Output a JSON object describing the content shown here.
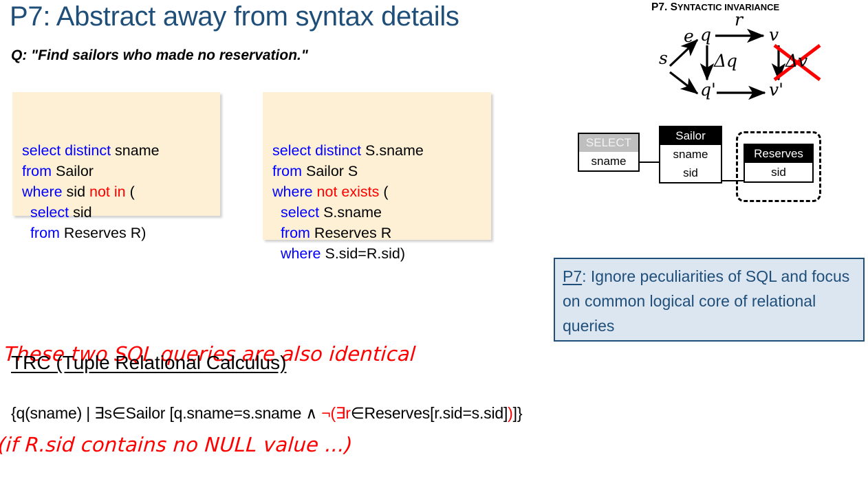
{
  "slide": {
    "title": "P7: Abstract away from syntax details",
    "question": "Q: \"Find sailors who made no reservation.\"",
    "title_color": "#1F4E79"
  },
  "code_blocks": [
    {
      "name": "sql-not-in",
      "background": "#FDF0D5",
      "lines": [
        [
          {
            "t": "select distinct ",
            "c": "kw"
          },
          {
            "t": "sname",
            "c": "id"
          }
        ],
        [
          {
            "t": "from ",
            "c": "kw"
          },
          {
            "t": "Sailor",
            "c": "id"
          }
        ],
        [
          {
            "t": "where ",
            "c": "kw"
          },
          {
            "t": "sid ",
            "c": "id"
          },
          {
            "t": "not in",
            "c": "neg"
          },
          {
            "t": " (",
            "c": "id"
          }
        ],
        [
          {
            "t": "  select ",
            "c": "kw"
          },
          {
            "t": "sid",
            "c": "id"
          }
        ],
        [
          {
            "t": "  from ",
            "c": "kw"
          },
          {
            "t": "Reserves R)",
            "c": "id"
          }
        ]
      ]
    },
    {
      "name": "sql-not-exists",
      "background": "#FDF0D5",
      "lines": [
        [
          {
            "t": "select distinct ",
            "c": "kw"
          },
          {
            "t": "S.sname",
            "c": "id"
          }
        ],
        [
          {
            "t": "from ",
            "c": "kw"
          },
          {
            "t": "Sailor S",
            "c": "id"
          }
        ],
        [
          {
            "t": "where ",
            "c": "kw"
          },
          {
            "t": "not exists",
            "c": "neg"
          },
          {
            "t": " (",
            "c": "id"
          }
        ],
        [
          {
            "t": "  select ",
            "c": "kw"
          },
          {
            "t": "S.sname",
            "c": "id"
          }
        ],
        [
          {
            "t": "  from ",
            "c": "kw"
          },
          {
            "t": "Reserves R",
            "c": "id"
          }
        ],
        [
          {
            "t": "  where ",
            "c": "kw"
          },
          {
            "t": "S.sid=R.sid)",
            "c": "id"
          }
        ]
      ]
    }
  ],
  "handwritten_note": {
    "line1": "These two SQL queries are also identical",
    "line2": "(if R.sid contains no NULL value ...)",
    "color": "#FF0000"
  },
  "trc": {
    "heading": "TRC (Tuple Relational Calculus)",
    "formula_parts": [
      {
        "t": "{q(sname) | ∃s∈Sailor [q.sname=s.sname ∧ ",
        "c": "id"
      },
      {
        "t": "¬(∃r",
        "c": "neg"
      },
      {
        "t": "∈Reserves[r.sid=s.sid]",
        "c": "id"
      },
      {
        "t": ")",
        "c": "neg"
      },
      {
        "t": "]}",
        "c": "id"
      }
    ]
  },
  "syntactic_diagram": {
    "title_first": "P7. S",
    "title_rest": "YNTACTIC INVARIANCE",
    "nodes": {
      "s": "s",
      "q": "q",
      "v": "v",
      "q_prime": "q'",
      "v_prime": "v'"
    },
    "edges": {
      "e": "e",
      "r": "r",
      "delta_q": "Δq",
      "delta_v": "Δv"
    },
    "cross_color": "#FF0000"
  },
  "relational_diagram": {
    "select_box": {
      "header": "SELECT",
      "cells": [
        "sname"
      ],
      "header_bg": "#BFBFBF"
    },
    "sailor_box": {
      "header": "Sailor",
      "cells": [
        "sname",
        "sid"
      ],
      "header_bg": "#000000"
    },
    "reserves_box": {
      "header": "Reserves",
      "cells": [
        "sid"
      ],
      "header_bg": "#000000"
    }
  },
  "callout": {
    "label": "P7",
    "text": ": Ignore peculiarities of SQL and focus on common logical core of relational queries",
    "background": "#DCE6F1",
    "border": "#1F4E79"
  }
}
